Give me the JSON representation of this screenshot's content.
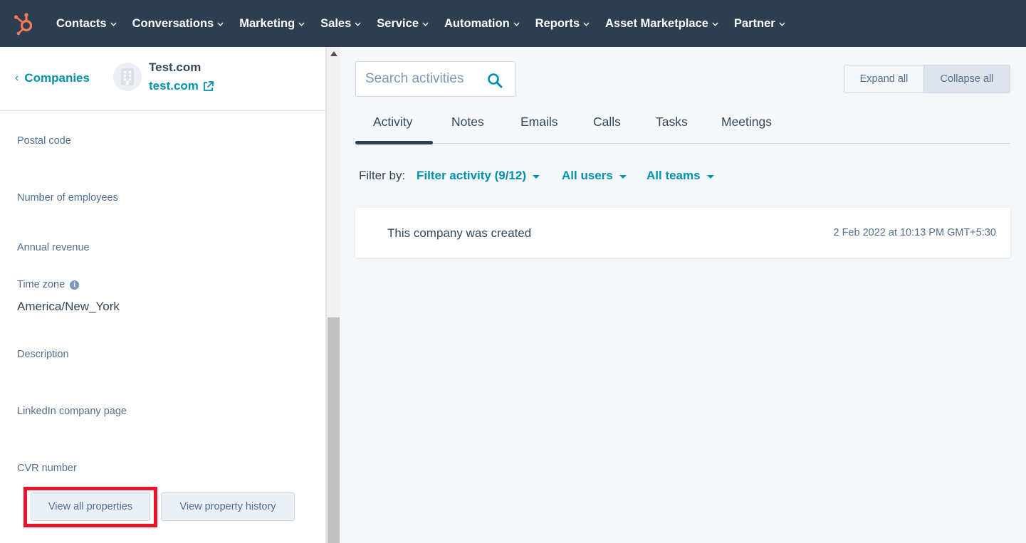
{
  "nav": {
    "logo_icon": "hubspot-sprocket-icon",
    "brand_color": "#ff7a59",
    "items": [
      {
        "label": "Contacts"
      },
      {
        "label": "Conversations"
      },
      {
        "label": "Marketing"
      },
      {
        "label": "Sales"
      },
      {
        "label": "Service"
      },
      {
        "label": "Automation"
      },
      {
        "label": "Reports"
      },
      {
        "label": "Asset Marketplace"
      },
      {
        "label": "Partner"
      }
    ]
  },
  "record": {
    "back_label": "Companies",
    "name": "Test.com",
    "domain": "test.com",
    "avatar_icon": "building-icon",
    "external_link_icon": "external-link-icon"
  },
  "properties": [
    {
      "label": "Postal code",
      "value": ""
    },
    {
      "label": "Number of employees",
      "value": ""
    },
    {
      "label": "Annual revenue",
      "value": ""
    },
    {
      "label": "Time zone",
      "value": "America/New_York",
      "info_icon": "info-icon"
    },
    {
      "label": "Description",
      "value": ""
    },
    {
      "label": "LinkedIn company page",
      "value": ""
    },
    {
      "label": "CVR number",
      "value": ""
    }
  ],
  "property_buttons": {
    "view_all": "View all properties",
    "view_history": "View property history"
  },
  "activity": {
    "search_placeholder": "Search activities",
    "expand_all": "Expand all",
    "collapse_all": "Collapse all",
    "tabs": [
      {
        "label": "Activity",
        "active": true
      },
      {
        "label": "Notes"
      },
      {
        "label": "Emails"
      },
      {
        "label": "Calls"
      },
      {
        "label": "Tasks"
      },
      {
        "label": "Meetings"
      }
    ],
    "filter_label": "Filter by:",
    "filters": [
      {
        "label": "Filter activity (9/12)"
      },
      {
        "label": "All users"
      },
      {
        "label": "All teams"
      }
    ],
    "items": [
      {
        "text": "This company was created",
        "timestamp": "2 Feb 2022 at 10:13 PM GMT+5:30"
      }
    ]
  },
  "colors": {
    "nav_bg": "#2d3e50",
    "link": "#0091ae",
    "highlight": "#e8152a"
  }
}
